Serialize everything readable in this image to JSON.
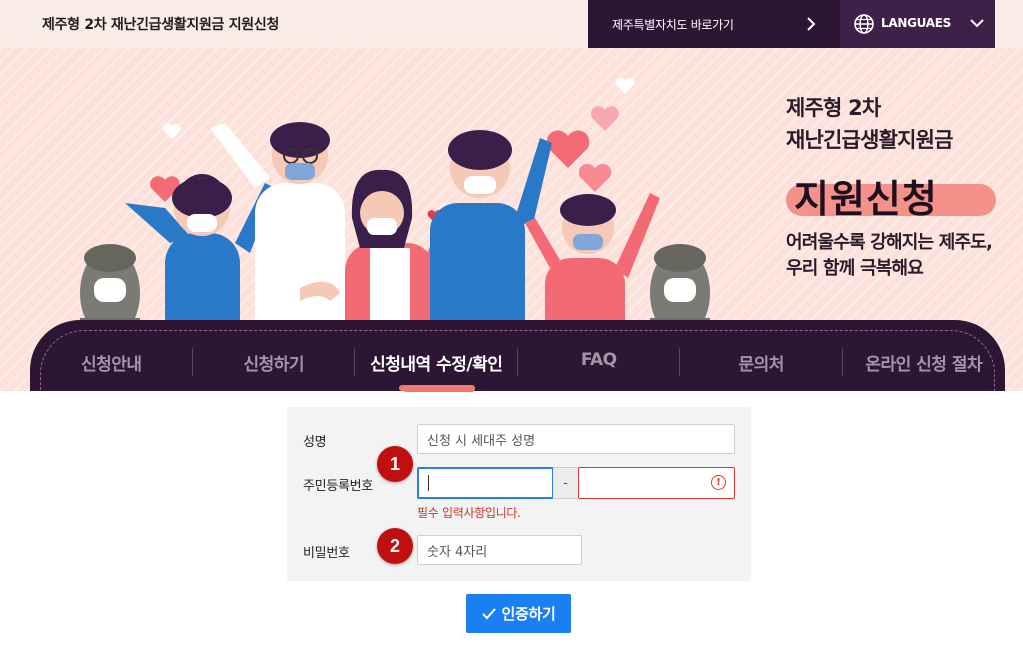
{
  "header": {
    "site_title": "제주형 2차 재난긴급생활지원금 지원신청",
    "jeju_link_label": "제주특별자치도 바로가기",
    "language_label": "LANGUAES"
  },
  "hero": {
    "line1": "제주형 2차",
    "line2": "재난긴급생활지원금",
    "badge": "지원신청",
    "sub1": "어려울수록 강해지는 제주도,",
    "sub2": "우리 함께 극복해요"
  },
  "nav": {
    "items": [
      {
        "label": "신청안내"
      },
      {
        "label": "신청하기"
      },
      {
        "label": "신청내역 수정/확인"
      },
      {
        "label": "FAQ"
      },
      {
        "label": "문의처"
      },
      {
        "label": "온라인 신청 절차"
      }
    ],
    "active_index": 2
  },
  "form": {
    "name_label": "성명",
    "name_placeholder": "신청 시 세대주 성명",
    "rrn_label": "주민등록번호",
    "rrn_front_value": "",
    "rrn_separator": "-",
    "rrn_back_value": "",
    "rrn_error": "필수 입력사항입니다.",
    "password_label": "비밀번호",
    "password_placeholder": "숫자 4자리",
    "verify_button": "인증하기"
  },
  "markers": [
    "1",
    "2"
  ],
  "colors": {
    "dark_purple": "#2c1633",
    "accent_coral": "#f4786e",
    "primary_blue": "#1a7ff0",
    "error_red": "#d33a2f",
    "marker_red": "#bf0f0f"
  }
}
